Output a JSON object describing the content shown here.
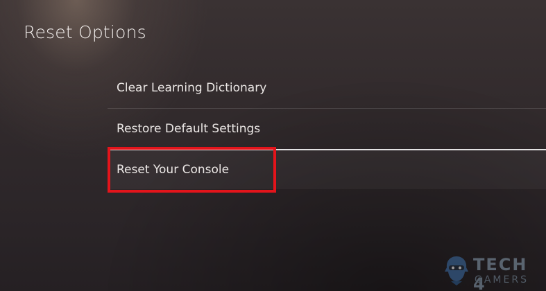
{
  "page": {
    "title": "Reset Options"
  },
  "menu": {
    "items": [
      {
        "label": "Clear Learning Dictionary"
      },
      {
        "label": "Restore Default Settings"
      },
      {
        "label": "Reset Your Console",
        "focused": true,
        "highlighted": true
      }
    ]
  },
  "annotation": {
    "highlight_color": "#e3141b"
  },
  "watermark": {
    "line1": "TECH 4",
    "line2": "GAMERS",
    "icon": "ninja-mascot-icon"
  }
}
